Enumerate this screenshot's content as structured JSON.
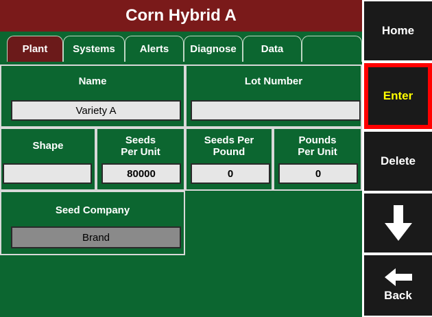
{
  "header": {
    "title": "Corn Hybrid A"
  },
  "tabs": [
    {
      "label": "Plant",
      "active": true
    },
    {
      "label": "Systems"
    },
    {
      "label": "Alerts"
    },
    {
      "label": "Diagnose"
    },
    {
      "label": "Data"
    }
  ],
  "fields": {
    "name": {
      "label": "Name",
      "value": "Variety A"
    },
    "lot_number": {
      "label": "Lot Number",
      "value": ""
    },
    "shape": {
      "label": "Shape",
      "value": ""
    },
    "seeds_per_unit": {
      "label": "Seeds\nPer Unit",
      "value": "80000"
    },
    "seeds_per_pound": {
      "label": "Seeds Per\nPound",
      "value": "0"
    },
    "pounds_per_unit": {
      "label": "Pounds\nPer Unit",
      "value": "0"
    },
    "seed_company": {
      "label": "Seed Company",
      "value": "Brand"
    }
  },
  "side_buttons": {
    "home": "Home",
    "enter": "Enter",
    "delete": "Delete",
    "down_icon": "down-arrow-icon",
    "back": "Back",
    "back_icon": "left-arrow-icon"
  },
  "colors": {
    "title_bg": "#7a1a1a",
    "panel_bg": "#0c6630",
    "active_tab": "#6b1a1a",
    "side_bg": "#1a1a1a",
    "enter_highlight": "#ff0000",
    "enter_text": "#ffff00"
  }
}
